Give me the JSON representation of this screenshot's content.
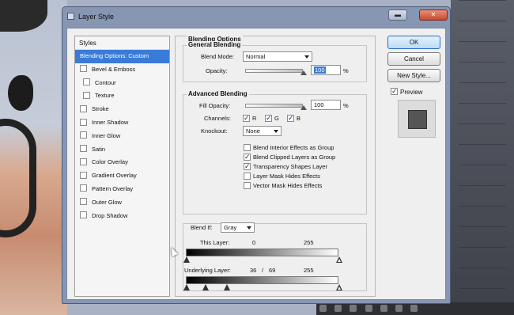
{
  "window": {
    "title": "Layer Style"
  },
  "styles_panel": {
    "header": "Styles",
    "items": [
      {
        "label": "Blending Options: Custom",
        "selected": true,
        "checkbox": false,
        "indent": false
      },
      {
        "label": "Bevel & Emboss",
        "checkbox": true,
        "indent": false
      },
      {
        "label": "Contour",
        "checkbox": true,
        "indent": true
      },
      {
        "label": "Texture",
        "checkbox": true,
        "indent": true
      },
      {
        "label": "Stroke",
        "checkbox": true,
        "indent": false
      },
      {
        "label": "Inner Shadow",
        "checkbox": true,
        "indent": false
      },
      {
        "label": "Inner Glow",
        "checkbox": true,
        "indent": false
      },
      {
        "label": "Satin",
        "checkbox": true,
        "indent": false
      },
      {
        "label": "Color Overlay",
        "checkbox": true,
        "indent": false
      },
      {
        "label": "Gradient Overlay",
        "checkbox": true,
        "indent": false
      },
      {
        "label": "Pattern Overlay",
        "checkbox": true,
        "indent": false
      },
      {
        "label": "Outer Glow",
        "checkbox": true,
        "indent": false
      },
      {
        "label": "Drop Shadow",
        "checkbox": true,
        "indent": false
      }
    ]
  },
  "blending_options": {
    "title": "Blending Options",
    "general": {
      "title": "General Blending",
      "blend_mode_label": "Blend Mode:",
      "blend_mode_value": "Normal",
      "opacity_label": "Opacity:",
      "opacity_value": "100",
      "opacity_unit": "%"
    },
    "advanced": {
      "title": "Advanced Blending",
      "fill_opacity_label": "Fill Opacity:",
      "fill_opacity_value": "100",
      "fill_opacity_unit": "%",
      "channels_label": "Channels:",
      "channels": [
        "R",
        "G",
        "B"
      ],
      "knockout_label": "Knockout:",
      "knockout_value": "None",
      "checkboxes": [
        {
          "label": "Blend Interior Effects as Group",
          "checked": false
        },
        {
          "label": "Blend Clipped Layers as Group",
          "checked": true
        },
        {
          "label": "Transparency Shapes Layer",
          "checked": true
        },
        {
          "label": "Layer Mask Hides Effects",
          "checked": false
        },
        {
          "label": "Vector Mask Hides Effects",
          "checked": false
        }
      ]
    },
    "blend_if": {
      "label": "Blend If:",
      "value": "Gray",
      "this_layer_label": "This Layer:",
      "this_layer_low": "0",
      "this_layer_high": "255",
      "underlying_label": "Underlying Layer:",
      "underlying_low": "36",
      "underlying_sep": "/",
      "underlying_mid": "69",
      "underlying_high": "255"
    }
  },
  "buttons": {
    "ok": "OK",
    "cancel": "Cancel",
    "new_style": "New Style..."
  },
  "preview": {
    "label": "Preview",
    "checked": true
  }
}
